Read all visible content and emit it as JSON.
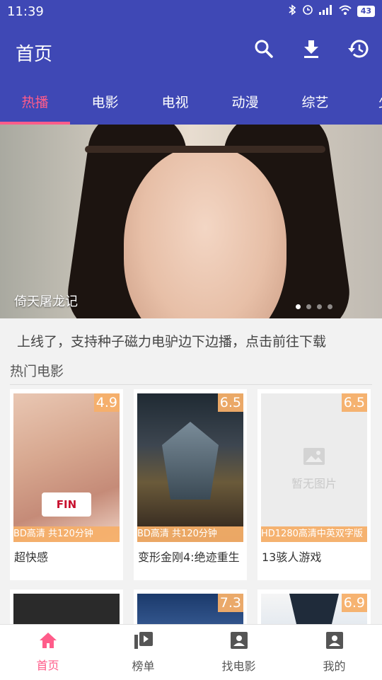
{
  "status_bar": {
    "time": "11:39",
    "battery": "43"
  },
  "app_bar": {
    "title": "首页"
  },
  "tabs": [
    {
      "label": "热播",
      "active": true
    },
    {
      "label": "电影"
    },
    {
      "label": "电视"
    },
    {
      "label": "动漫"
    },
    {
      "label": "综艺"
    },
    {
      "label": "少"
    }
  ],
  "banner": {
    "caption": "倚天屠龙记"
  },
  "notice": "上线了，支持种子磁力电驴边下边播，点击前往下载",
  "section": {
    "title": "热门电影"
  },
  "movies": [
    {
      "title": "超快感",
      "score": "4.9",
      "quality": "BD高清 共120分钟"
    },
    {
      "title": "变形金刚4:绝迹重生",
      "score": "6.5",
      "quality": "BD高清 共120分钟"
    },
    {
      "title": "13骇人游戏",
      "score": "6.5",
      "quality": "HD1280高清中英双字版",
      "placeholder": "暂无图片"
    },
    {
      "title": "",
      "score": ""
    },
    {
      "title": "",
      "score": "7.3"
    },
    {
      "title": "",
      "score": "6.9"
    }
  ],
  "bottom_nav": [
    {
      "label": "首页",
      "active": true,
      "icon": "home-icon"
    },
    {
      "label": "榜单",
      "icon": "playlist-icon"
    },
    {
      "label": "找电影",
      "icon": "find-movie-icon"
    },
    {
      "label": "我的",
      "icon": "profile-icon"
    }
  ],
  "colors": {
    "primary": "#3f48b5",
    "accent": "#ff5c8a",
    "badge": "#f5af69"
  }
}
